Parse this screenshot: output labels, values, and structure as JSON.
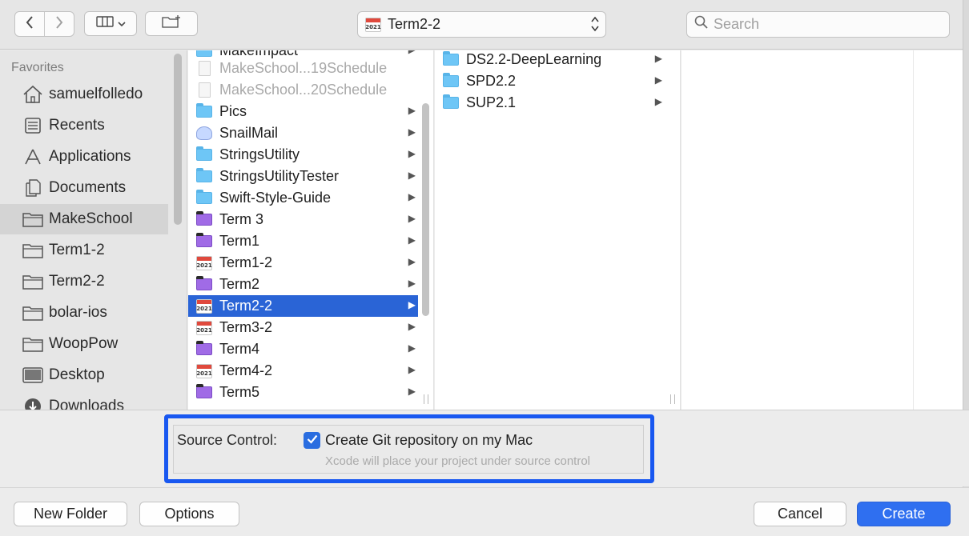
{
  "toolbar": {
    "path_popup_value": "Term2-2",
    "path_popup_icon_text": "2021",
    "search_placeholder": "Search",
    "back_icon": "chevron-left-icon",
    "forward_icon": "chevron-right-icon",
    "view_icon": "column-view-icon",
    "new_folder_icon": "new-folder-icon"
  },
  "sidebar": {
    "section_title": "Favorites",
    "items": [
      {
        "label": "samuelfolledo",
        "icon": "home-icon"
      },
      {
        "label": "Recents",
        "icon": "recents-icon"
      },
      {
        "label": "Applications",
        "icon": "applications-icon"
      },
      {
        "label": "Documents",
        "icon": "documents-icon"
      },
      {
        "label": "MakeSchool",
        "icon": "folder-icon",
        "selected": true
      },
      {
        "label": "Term1-2",
        "icon": "folder-icon"
      },
      {
        "label": "Term2-2",
        "icon": "folder-icon"
      },
      {
        "label": "bolar-ios",
        "icon": "folder-icon"
      },
      {
        "label": "WoopPow",
        "icon": "folder-icon"
      },
      {
        "label": "Desktop",
        "icon": "desktop-icon"
      },
      {
        "label": "Downloads",
        "icon": "downloads-icon"
      }
    ]
  },
  "column1": {
    "items": [
      {
        "label": "MakeImpact",
        "type": "folder"
      },
      {
        "label": "MakeSchool...19Schedule",
        "type": "doc",
        "dim": true
      },
      {
        "label": "MakeSchool...20Schedule",
        "type": "doc",
        "dim": true
      },
      {
        "label": "Pics",
        "type": "folder"
      },
      {
        "label": "SnailMail",
        "type": "snail"
      },
      {
        "label": "StringsUtility",
        "type": "folder"
      },
      {
        "label": "StringsUtilityTester",
        "type": "folder"
      },
      {
        "label": "Swift-Style-Guide",
        "type": "folder"
      },
      {
        "label": "Term 3",
        "type": "purple"
      },
      {
        "label": "Term1",
        "type": "purple"
      },
      {
        "label": "Term1-2",
        "type": "calendar",
        "cal_text": "2021"
      },
      {
        "label": "Term2",
        "type": "purple"
      },
      {
        "label": "Term2-2",
        "type": "calendar",
        "cal_text": "2021",
        "selected": true
      },
      {
        "label": "Term3-2",
        "type": "calendar",
        "cal_text": "2021"
      },
      {
        "label": "Term4",
        "type": "purple"
      },
      {
        "label": "Term4-2",
        "type": "calendar",
        "cal_text": "2021"
      },
      {
        "label": "Term5",
        "type": "purple"
      }
    ]
  },
  "column2": {
    "items": [
      {
        "label": "DS2.2-DeepLearning",
        "type": "folder"
      },
      {
        "label": "SPD2.2",
        "type": "folder"
      },
      {
        "label": "SUP2.1",
        "type": "folder"
      }
    ]
  },
  "source_control": {
    "label": "Source Control:",
    "checkbox_label": "Create Git repository on my Mac",
    "checked": true,
    "hint": "Xcode will place your project under source control"
  },
  "footer": {
    "new_folder": "New Folder",
    "options": "Options",
    "cancel": "Cancel",
    "create": "Create"
  },
  "colors": {
    "selection": "#2a64d6",
    "primary_button": "#2f6ff0",
    "highlight_border": "#1857f0"
  }
}
